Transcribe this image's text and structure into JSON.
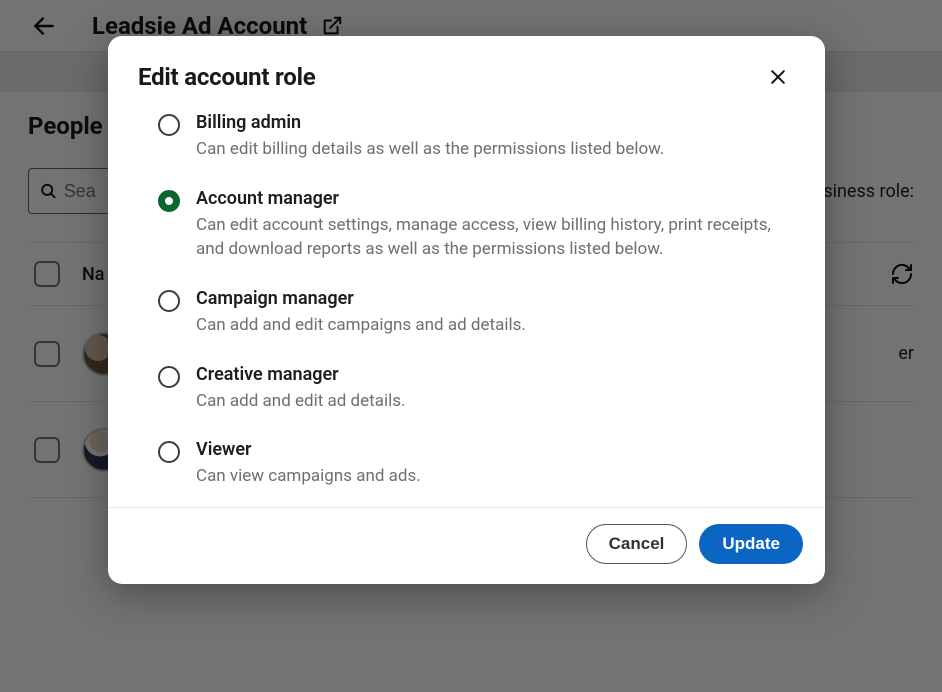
{
  "background": {
    "account_title": "Leadsie Ad Account",
    "section_title": "People",
    "search_placeholder": "Sea",
    "business_role_label": "usiness role:",
    "table": {
      "name_header": "Na",
      "row1_right": "er",
      "row2_right": ""
    }
  },
  "modal": {
    "title": "Edit account role",
    "selected_index": 1,
    "options": [
      {
        "label": "Billing admin",
        "desc": "Can edit billing details as well as the permissions listed below."
      },
      {
        "label": "Account manager",
        "desc": "Can edit account settings, manage access, view billing history, print receipts, and download reports as well as the permissions listed below."
      },
      {
        "label": "Campaign manager",
        "desc": "Can add and edit campaigns and ad details."
      },
      {
        "label": "Creative manager",
        "desc": "Can add and edit ad details."
      },
      {
        "label": "Viewer",
        "desc": "Can view campaigns and ads."
      }
    ],
    "buttons": {
      "cancel": "Cancel",
      "update": "Update"
    }
  }
}
